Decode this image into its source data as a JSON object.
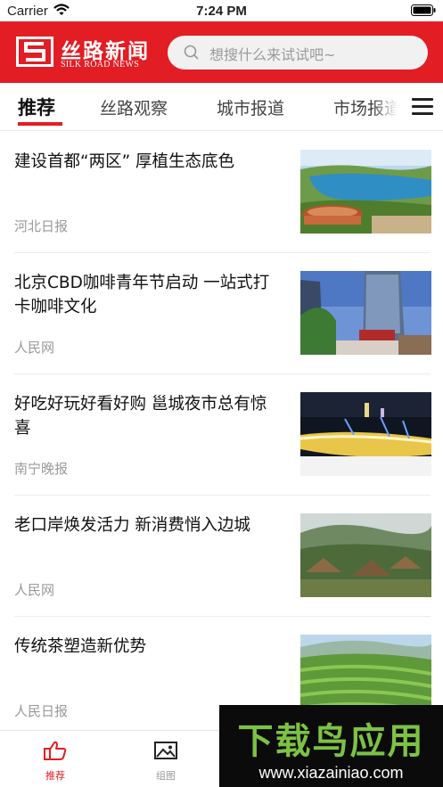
{
  "status_bar": {
    "carrier": "Carrier",
    "time": "7:24 PM"
  },
  "header": {
    "brand_name": "丝路新闻",
    "brand_sub": "SILK ROAD NEWS",
    "search_placeholder": "想搜什么来试试吧~",
    "background_color": "#e21d24"
  },
  "tabs": [
    {
      "label": "推荐",
      "active": true
    },
    {
      "label": "丝路观察",
      "active": false
    },
    {
      "label": "城市报道",
      "active": false
    },
    {
      "label": "市场报道",
      "active": false
    }
  ],
  "menu_icon": "hamburger-menu-icon",
  "news": [
    {
      "title": "建设首都“两区” 厚植生态底色",
      "source": "河北日报",
      "image": "lake-town-photo"
    },
    {
      "title": "北京CBD咖啡青年节启动 一站式打卡咖啡文化",
      "source": "人民网",
      "image": "cbd-tower-photo"
    },
    {
      "title": "好吃好玩好看好购 邕城夜市总有惊喜",
      "source": "南宁晚报",
      "image": "night-market-photo"
    },
    {
      "title": "老口岸焕发活力 新消费悄入边城",
      "source": "人民网",
      "image": "village-hills-photo"
    },
    {
      "title": "传统茶塑造新优势",
      "source": "人民日报",
      "image": "tea-terrace-photo"
    }
  ],
  "bottom_tabs": [
    {
      "label": "推荐",
      "icon": "thumbs-up-icon",
      "active": true
    },
    {
      "label": "组图",
      "icon": "picture-icon",
      "active": false
    }
  ],
  "watermark": {
    "title": "下载鸟应用",
    "url": "www.xiazainiao.com"
  }
}
